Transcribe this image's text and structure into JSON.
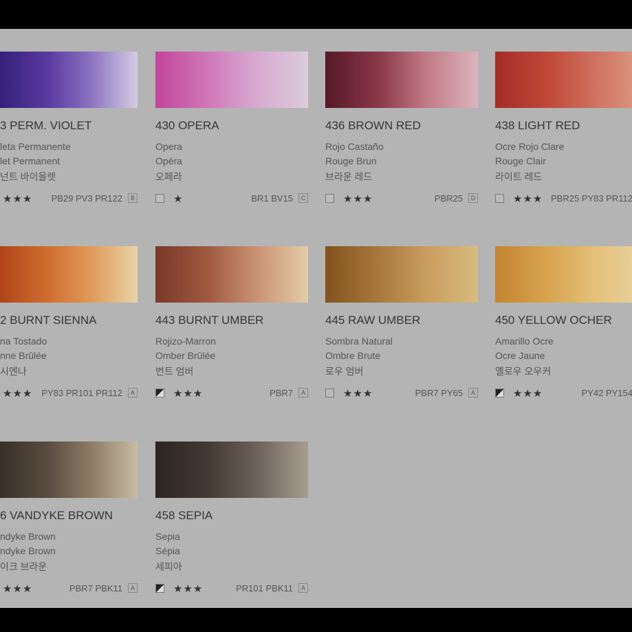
{
  "rows": [
    [
      {
        "title": "3 PERM. VIOLET",
        "es": "leta Permanente",
        "fr": "let Permanent",
        "ko": "넌트 바이올렛",
        "transparency": "none",
        "stars": "★★★",
        "pigments": "PB29 PV3 PR122",
        "badge": "B",
        "colors": [
          "#34207a",
          "#5a3aa0",
          "#8a70c0",
          "#d4cce4"
        ]
      },
      {
        "title": "430 OPERA",
        "es": "Opera",
        "fr": "Opéra",
        "ko": "오페라",
        "transparency": "transparent",
        "stars": "★",
        "pigments": "BR1 BV15",
        "badge": "C",
        "colors": [
          "#c2449a",
          "#d078b8",
          "#d8a8d0",
          "#dcccdc"
        ]
      },
      {
        "title": "436 BROWN RED",
        "es": "Rojo Castaño",
        "fr": "Rouge Brun",
        "ko": "브라운 레드",
        "transparency": "transparent",
        "stars": "★★★",
        "pigments": "PBR25",
        "badge": "D",
        "colors": [
          "#561828",
          "#8a3848",
          "#c07884",
          "#dcb4bc"
        ]
      },
      {
        "title": "438 LIGHT RED",
        "es": "Ocre Rojo Clare",
        "fr": "Rouge Clair",
        "ko": "라이트 레드",
        "transparency": "semi-transparent",
        "stars": "★★★",
        "pigments": "PBR25 PY83 PR112",
        "badge": "",
        "colors": [
          "#a42c28",
          "#c04838",
          "#d07060",
          "#dca088"
        ]
      }
    ],
    [
      {
        "title": "2 BURNT SIENNA",
        "es": "na Tostado",
        "fr": "nne Brûlée",
        "ko": " 시엔나",
        "transparency": "none",
        "stars": "★★★",
        "pigments": "PY83 PR101 PR112",
        "badge": "A",
        "colors": [
          "#b04418",
          "#d06e30",
          "#e09858",
          "#e8d4a8"
        ]
      },
      {
        "title": "443 BURNT UMBER",
        "es": "Rojizo-Marron",
        "fr": "Omber  Brûlée",
        "ko": "번트 엄버",
        "transparency": "semi-opaque",
        "stars": "★★★",
        "pigments": "PBR7",
        "badge": "A",
        "colors": [
          "#7a3828",
          "#a05a40",
          "#c89070",
          "#e4cca8"
        ]
      },
      {
        "title": "445 RAW UMBER",
        "es": "Sombra Natural",
        "fr": "Ombre Brute",
        "ko": "로우 엄버",
        "transparency": "semi-transparent",
        "stars": "★★★",
        "pigments": "PBR7 PY65",
        "badge": "A",
        "colors": [
          "#82521e",
          "#a8783c",
          "#c89c5c",
          "#d8bc80"
        ]
      },
      {
        "title": "450 YELLOW OCHER",
        "es": "Amarillo Ocre",
        "fr": "Ocre Jaune",
        "ko": "옐로우 오우커",
        "transparency": "semi-opaque",
        "stars": "★★★",
        "pigments": "PY42 PY154",
        "badge": "",
        "colors": [
          "#c48430",
          "#d8a450",
          "#e4c078",
          "#e8d4a4"
        ]
      }
    ],
    [
      {
        "title": "6 VANDYKE BROWN",
        "es": "ndyke Brown",
        "fr": "ndyke Brown",
        "ko": "이크 브라운",
        "transparency": "none",
        "stars": "★★★",
        "pigments": "PBR7 PBK11",
        "badge": "A",
        "colors": [
          "#383028",
          "#5a4c40",
          "#8a7a64",
          "#cabca4"
        ]
      },
      {
        "title": "458 SEPIA",
        "es": "Sepia",
        "fr": "Sépia",
        "ko": "세피아",
        "transparency": "semi-opaque",
        "stars": "★★★",
        "pigments": "PR101 PBK11",
        "badge": "A",
        "colors": [
          "#2c2420",
          "#443a34",
          "#6a6058",
          "#a89c90"
        ]
      }
    ]
  ]
}
